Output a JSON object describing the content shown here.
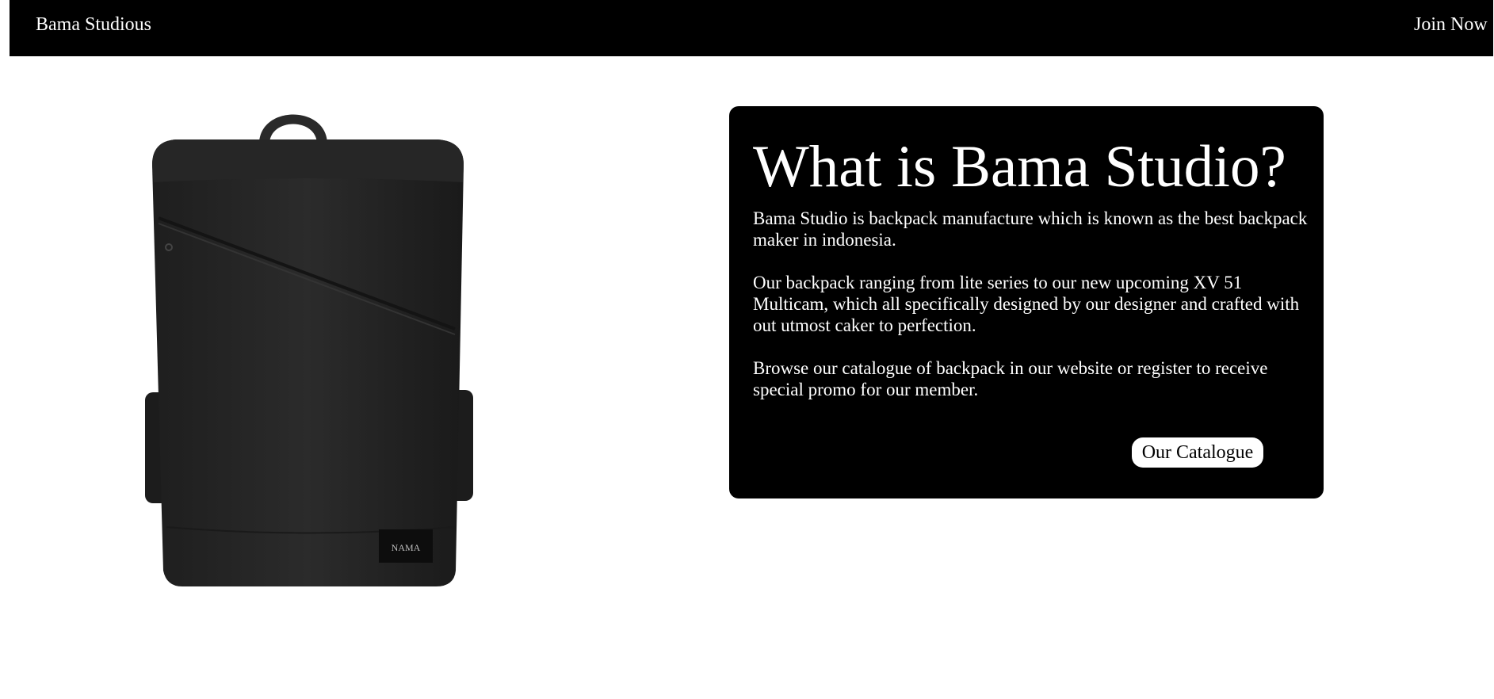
{
  "navbar": {
    "brand": "Bama Studious",
    "join_label": "Join Now"
  },
  "hero": {
    "image_icon": "backpack-image",
    "badge_text": "NAMA"
  },
  "info_card": {
    "title": "What is Bama Studio?",
    "paragraphs": [
      "Bama Studio is backpack manufacture which is known as the best backpack maker in indonesia.",
      "Our backpack ranging from lite series to our new upcoming XV 51 Multicam, which all specifically designed by our designer and crafted with out utmost caker to perfection.",
      "Browse our catalogue of backpack in our website or register to receive special promo for our member."
    ],
    "button_label": "Our Catalogue"
  },
  "colors": {
    "background": "#ffffff",
    "navbar": "#000000",
    "card": "#000000",
    "button": "#ffffff",
    "text_light": "#ffffff",
    "text_dark": "#000000"
  }
}
